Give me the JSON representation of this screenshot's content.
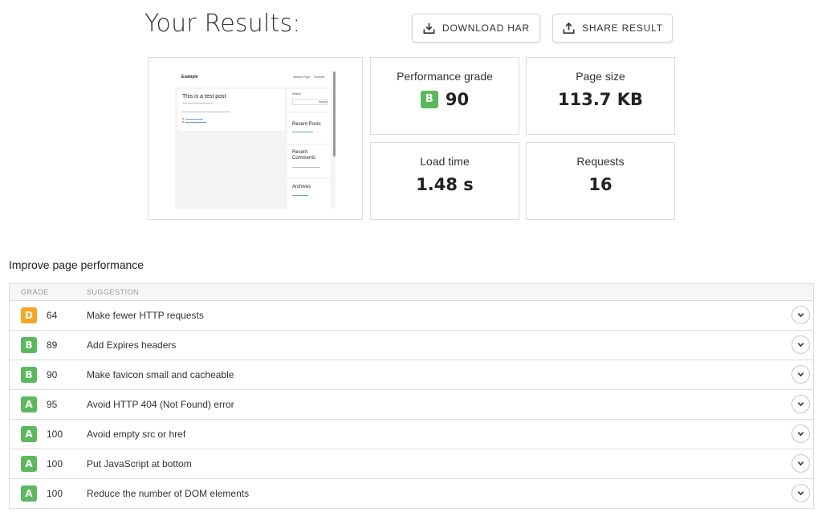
{
  "colors": {
    "grade_A": "#5cb85c",
    "grade_B": "#5cb85c",
    "grade_D": "#f5a623",
    "border": "#dcdcdc",
    "link_blue": "#6b9bd1"
  },
  "header": {
    "title": "Your Results:",
    "download_label": "DOWNLOAD HAR",
    "share_label": "SHARE RESULT",
    "download_icon": "download-icon",
    "share_icon": "share-icon"
  },
  "thumbnail": {
    "brand": "Example",
    "nav": [
      "Sample Page",
      "Example"
    ],
    "post_title": "This is a test post",
    "sidebar": {
      "search_label": "Search",
      "search_button": "Search",
      "recent_posts": "Recent Posts",
      "recent_comments": "Recent Comments",
      "archives": "Archives"
    }
  },
  "metrics": {
    "performance_grade": {
      "label": "Performance grade",
      "grade": "B",
      "value": "90"
    },
    "page_size": {
      "label": "Page size",
      "value": "113.7 KB"
    },
    "load_time": {
      "label": "Load time",
      "value": "1.48 s"
    },
    "requests": {
      "label": "Requests",
      "value": "16"
    }
  },
  "improve": {
    "title": "Improve page performance",
    "columns": {
      "grade": "GRADE",
      "suggestion": "SUGGESTION"
    },
    "rows": [
      {
        "grade": "D",
        "score": "64",
        "suggestion": "Make fewer HTTP requests"
      },
      {
        "grade": "B",
        "score": "89",
        "suggestion": "Add Expires headers"
      },
      {
        "grade": "B",
        "score": "90",
        "suggestion": "Make favicon small and cacheable"
      },
      {
        "grade": "A",
        "score": "95",
        "suggestion": "Avoid HTTP 404 (Not Found) error"
      },
      {
        "grade": "A",
        "score": "100",
        "suggestion": "Avoid empty src or href"
      },
      {
        "grade": "A",
        "score": "100",
        "suggestion": "Put JavaScript at bottom"
      },
      {
        "grade": "A",
        "score": "100",
        "suggestion": "Reduce the number of DOM elements"
      }
    ]
  }
}
